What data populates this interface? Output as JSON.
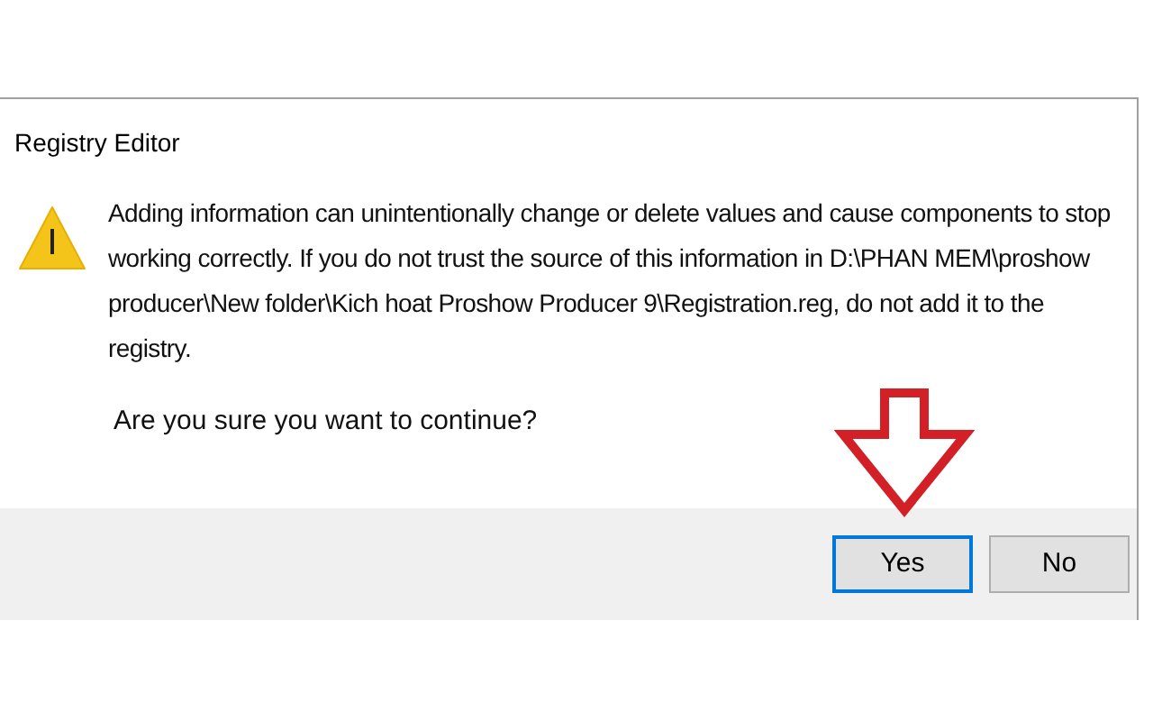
{
  "window": {
    "title": "Registry Editor"
  },
  "message": {
    "kind": "warning",
    "text": "Adding information can unintentionally change or delete values and cause components to stop working correctly. If you do not trust the source of this information in D:\\PHAN MEM\\proshow producer\\New folder\\Kich hoat Proshow Producer 9\\Registration.reg, do not add it to the registry."
  },
  "question": "Are you sure you want to continue?",
  "annotation": {
    "kind": "arrow"
  },
  "buttons": [
    {
      "label": "Yes",
      "focused": true
    },
    {
      "label": "No",
      "focused": false
    }
  ]
}
